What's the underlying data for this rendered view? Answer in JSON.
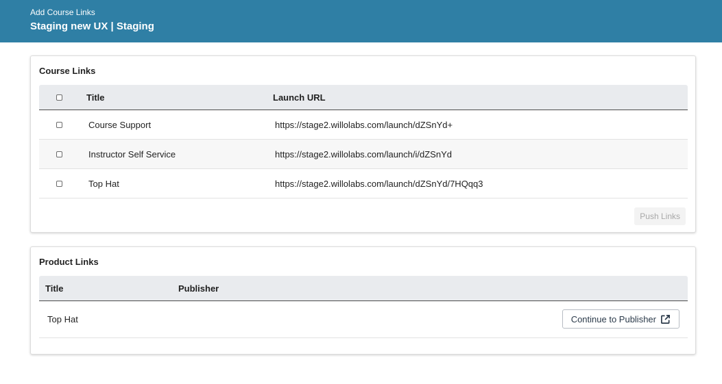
{
  "header": {
    "subtitle": "Add Course Links",
    "title": "Staging new UX | Staging"
  },
  "course_links": {
    "heading": "Course Links",
    "columns": {
      "title": "Title",
      "url": "Launch URL"
    },
    "rows": [
      {
        "title": "Course Support",
        "url": "https://stage2.willolabs.com/launch/dZSnYd+"
      },
      {
        "title": "Instructor Self Service",
        "url": "https://stage2.willolabs.com/launch/i/dZSnYd"
      },
      {
        "title": "Top Hat",
        "url": "https://stage2.willolabs.com/launch/dZSnYd/7HQqq3"
      }
    ],
    "push_label": "Push Links"
  },
  "product_links": {
    "heading": "Product Links",
    "columns": {
      "title": "Title",
      "publisher": "Publisher"
    },
    "rows": [
      {
        "title": "Top Hat",
        "publisher": "",
        "action": "Continue to Publisher"
      }
    ]
  },
  "icons": {
    "external": "external-link-icon"
  },
  "colors": {
    "header_bg": "#2f7fa5",
    "table_head_bg": "#e9ebee"
  }
}
